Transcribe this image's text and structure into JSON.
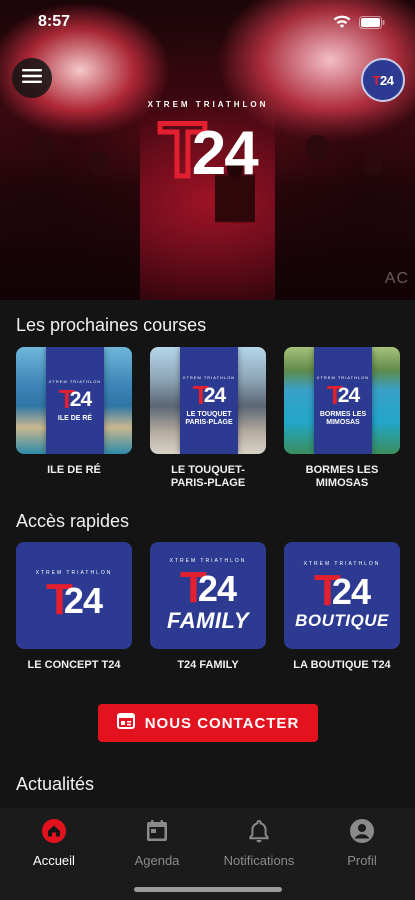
{
  "status_bar": {
    "time": "8:57"
  },
  "hero": {
    "tagline": "XTREM TRIATHLON",
    "logo_t": "T",
    "logo_num": "24",
    "watermark": "AC",
    "avatar_t": "T",
    "avatar_num": "24"
  },
  "races": {
    "title": "Les prochaines courses",
    "items": [
      {
        "label": "ILE DE RÉ",
        "badge": "ILE DE RÉ"
      },
      {
        "label": "LE TOUQUET-\nPARIS-PLAGE",
        "badge": "LE TOUQUET PARIS-PLAGE"
      },
      {
        "label": "BORMES LES\nMIMOSAS",
        "badge": "BORMES LES MIMOSAS"
      }
    ]
  },
  "quick_access": {
    "title": "Accès rapides",
    "items": [
      {
        "label": "LE CONCEPT T24",
        "word": ""
      },
      {
        "label": "T24 FAMILY",
        "word": "FAMILY"
      },
      {
        "label": "LA BOUTIQUE T24",
        "word": "BOUTIQUE"
      }
    ]
  },
  "contact": {
    "label": "NOUS CONTACTER"
  },
  "news": {
    "title": "Actualités"
  },
  "tabs": [
    {
      "label": "Accueil",
      "icon": "home-icon",
      "active": true
    },
    {
      "label": "Agenda",
      "icon": "calendar-icon",
      "active": false
    },
    {
      "label": "Notifications",
      "icon": "bell-icon",
      "active": false
    },
    {
      "label": "Profil",
      "icon": "user-icon",
      "active": false
    }
  ],
  "colors": {
    "brand_red": "#e2202f",
    "brand_blue": "#2d3a91",
    "background": "#141414",
    "active_tab_icon": "#e3121f"
  }
}
